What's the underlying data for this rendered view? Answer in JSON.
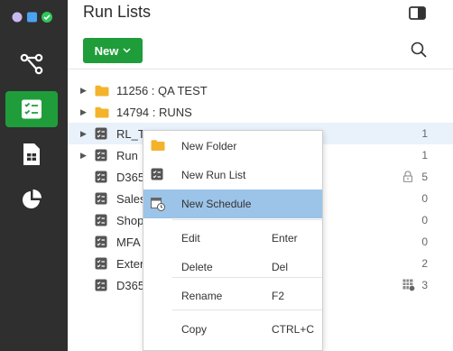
{
  "app": {
    "title": "Run Lists",
    "new_button": "New",
    "colors": {
      "rail": "#2f2f2f",
      "accent": "#1f9d3a",
      "highlight": "#9cc4e8",
      "selected_row": "#e9f2fb",
      "folder": "#f3b32b"
    }
  },
  "rail": {
    "items": [
      {
        "icon": "workflow-icon"
      },
      {
        "icon": "runlist-icon",
        "active": true
      },
      {
        "icon": "report-icon"
      },
      {
        "icon": "pie-chart-icon"
      }
    ]
  },
  "tree": [
    {
      "type": "folder",
      "label": "11256 : QA TEST",
      "count": ""
    },
    {
      "type": "folder",
      "label": "14794 : RUNS",
      "count": ""
    },
    {
      "type": "runlist",
      "label": "RL_Te",
      "count": "1",
      "expandable": true,
      "selected": true
    },
    {
      "type": "runlist",
      "label": "Run",
      "count": "1",
      "expandable": true
    },
    {
      "type": "runlist",
      "label": "D365",
      "count": "5",
      "extra": "lock-icon"
    },
    {
      "type": "runlist",
      "label": "Sales",
      "count": "0"
    },
    {
      "type": "runlist",
      "label": "Shop",
      "count": "0"
    },
    {
      "type": "runlist",
      "label": "MFA",
      "count": "0"
    },
    {
      "type": "runlist",
      "label": "Exter",
      "count": "2"
    },
    {
      "type": "runlist",
      "label": "D365",
      "count": "3",
      "extra": "schedule-grid-icon"
    }
  ],
  "context_menu": {
    "items": [
      {
        "label": "New Folder",
        "key": "",
        "icon": "folder-icon"
      },
      {
        "label": "New Run List",
        "key": "",
        "icon": "runlist-icon"
      },
      {
        "label": "New Schedule",
        "key": "",
        "icon": "schedule-icon",
        "highlighted": true
      },
      {
        "label": "Edit",
        "key": "Enter",
        "icon": ""
      },
      {
        "label": "Delete",
        "key": "Del",
        "icon": ""
      },
      {
        "label": "Rename",
        "key": "F2",
        "icon": ""
      },
      {
        "label": "Copy",
        "key": "CTRL+C",
        "icon": ""
      }
    ]
  }
}
